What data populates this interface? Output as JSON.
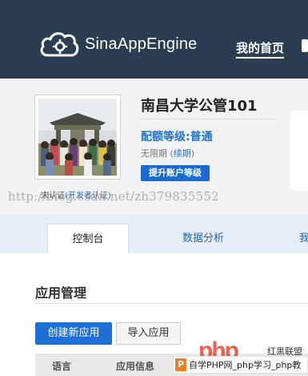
{
  "header": {
    "logo_text": "SinaAppEngine",
    "nav_home": "我的首页"
  },
  "profile": {
    "app_name": "南昌大学公管101",
    "quota_label": "配额等级:普通",
    "validity_prefix": "无限期 (",
    "renew_link": "续期",
    "validity_suffix": ")",
    "upgrade_button": "提升账户等级",
    "unverified_label": "未认证",
    "developer_verify_link": "(开发者认证)"
  },
  "watermark_text": "http://blog.csdn.net/zh379835552",
  "tabs": [
    {
      "label": "控制台"
    },
    {
      "label": "数据分析"
    },
    {
      "label": "我"
    }
  ],
  "main": {
    "section_title": "应用管理",
    "create_button": "创建新应用",
    "import_button": "导入应用",
    "table_headers": [
      "语言",
      "应用信息"
    ]
  },
  "overlay": {
    "php_logo_text": "php",
    "hongheilianmeng": "红黑联盟",
    "php_badge_icon": "P",
    "php_badge_text": "自学PHP网_php学习_php教"
  },
  "colors": {
    "header_bg": "#2b3d50",
    "accent_blue": "#1d6fd6",
    "tab_bar_bg": "#e5eef7"
  }
}
